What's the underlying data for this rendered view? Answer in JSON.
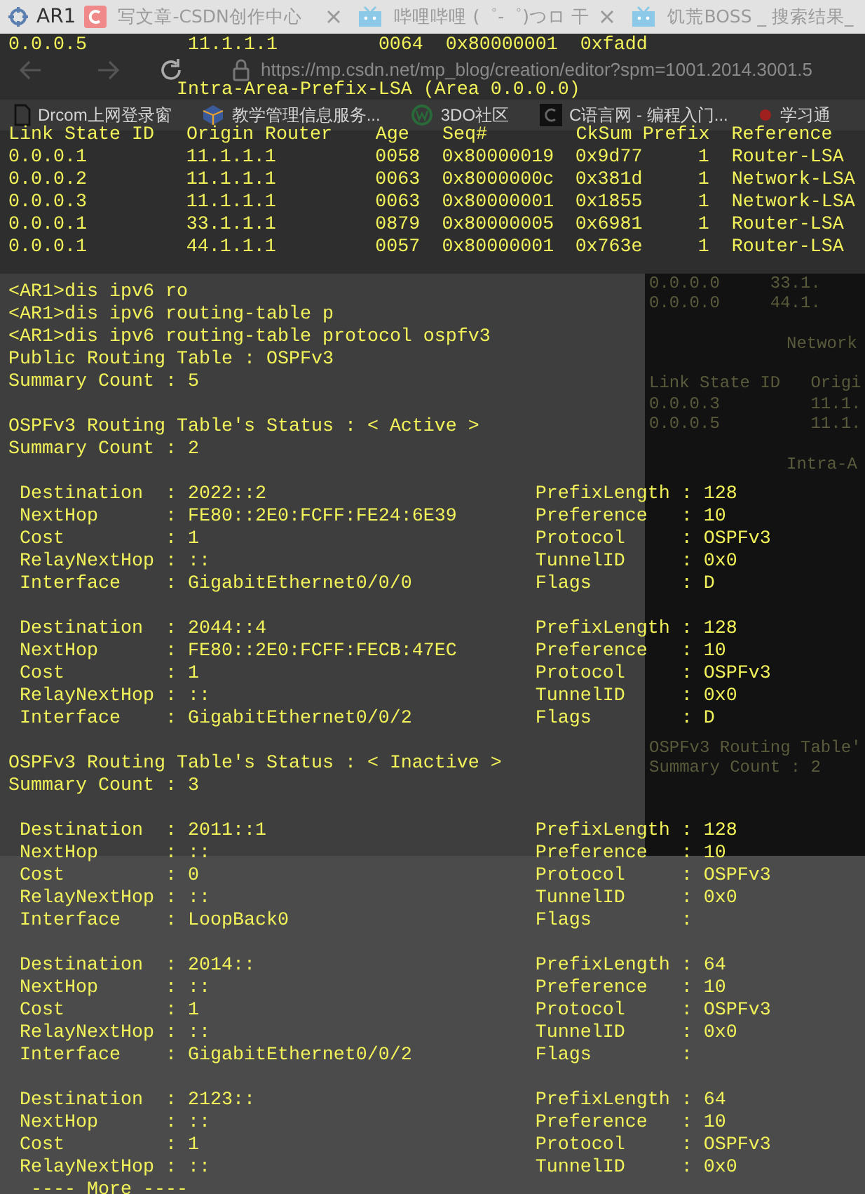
{
  "window": {
    "title": "AR1"
  },
  "browser": {
    "tabs": [
      {
        "title": "写文章-CSDN创作中心"
      },
      {
        "title": "哔哩哔哩 (゜-゜)つロ 干"
      },
      {
        "title": "饥荒BOSS _ 搜索结果_"
      }
    ],
    "url": "https://mp.csdn.net/mp_blog/creation/editor?spm=1001.2014.3001.5",
    "bookmarks": [
      {
        "label": "Drcom上网登录窗"
      },
      {
        "label": "教学管理信息服务..."
      },
      {
        "label": "3DO社区"
      },
      {
        "label": "C语言网 - 编程入门..."
      },
      {
        "label": "学习通"
      }
    ],
    "panel": {
      "top_groups": [
        {
          "kind": "rows",
          "lines": [
            "0.0.0.0     33.1.",
            "0.0.0.0     44.1."
          ]
        },
        {
          "kind": "heading",
          "lines": [
            "Network"
          ]
        },
        {
          "kind": "rows",
          "lines": [
            "Link State ID   Origi",
            "0.0.0.3         11.1.",
            "0.0.0.5         11.1."
          ]
        },
        {
          "kind": "heading",
          "lines": [
            "Intra-A"
          ]
        }
      ],
      "lower_lines": [
        "OSPFv3 Routing Table'",
        "Summary Count : 2"
      ]
    }
  },
  "terminal": {
    "lsa_tail": [
      "0.0.0.5",
      "11.1.1.1",
      "0064",
      "0x80000001",
      "0xfadd"
    ],
    "lsa_title": "Intra-Area-Prefix-LSA (Area 0.0.0.0)",
    "lsa_columns": [
      "Link State ID",
      "Origin Router",
      "Age",
      "Seq#",
      "CkSum",
      "Prefix",
      "Reference"
    ],
    "lsa_rows": [
      [
        "0.0.0.1",
        "11.1.1.1",
        "0058",
        "0x80000019",
        "0x9d77",
        "1",
        "Router-LSA"
      ],
      [
        "0.0.0.2",
        "11.1.1.1",
        "0063",
        "0x8000000c",
        "0x381d",
        "1",
        "Network-LSA"
      ],
      [
        "0.0.0.3",
        "11.1.1.1",
        "0063",
        "0x80000001",
        "0x1855",
        "1",
        "Network-LSA"
      ],
      [
        "0.0.0.1",
        "33.1.1.1",
        "0879",
        "0x80000005",
        "0x6981",
        "1",
        "Router-LSA"
      ],
      [
        "0.0.0.1",
        "44.1.1.1",
        "0057",
        "0x80000001",
        "0x763e",
        "1",
        "Router-LSA"
      ]
    ],
    "output": [
      "<AR1>dis ipv6 ro",
      "<AR1>dis ipv6 routing-table p",
      "<AR1>dis ipv6 routing-table protocol ospfv3",
      "Public Routing Table : OSPFv3",
      "Summary Count : 5"
    ],
    "sections": [
      {
        "status": "OSPFv3 Routing Table's Status : < Active >",
        "count": "Summary Count : 2",
        "routes": [
          [
            [
              "Destination  : 2022::2",
              "PrefixLength : 128"
            ],
            [
              "NextHop      : FE80::2E0:FCFF:FE24:6E39",
              "Preference   : 10"
            ],
            [
              "Cost         : 1",
              "Protocol     : OSPFv3"
            ],
            [
              "RelayNextHop : ::",
              "TunnelID     : 0x0"
            ],
            [
              "Interface    : GigabitEthernet0/0/0",
              "Flags        : D"
            ]
          ],
          [
            [
              "Destination  : 2044::4",
              "PrefixLength : 128"
            ],
            [
              "NextHop      : FE80::2E0:FCFF:FECB:47EC",
              "Preference   : 10"
            ],
            [
              "Cost         : 1",
              "Protocol     : OSPFv3"
            ],
            [
              "RelayNextHop : ::",
              "TunnelID     : 0x0"
            ],
            [
              "Interface    : GigabitEthernet0/0/2",
              "Flags        : D"
            ]
          ]
        ]
      },
      {
        "status": "OSPFv3 Routing Table's Status : < Inactive >",
        "count": "Summary Count : 3",
        "routes": [
          [
            [
              "Destination  : 2011::1",
              "PrefixLength : 128"
            ],
            [
              "NextHop      : ::",
              "Preference   : 10"
            ],
            [
              "Cost         : 0",
              "Protocol     : OSPFv3"
            ],
            [
              "RelayNextHop : ::",
              "TunnelID     : 0x0"
            ],
            [
              "Interface    : LoopBack0",
              "Flags        :"
            ]
          ],
          [
            [
              "Destination  : 2014::",
              "PrefixLength : 64"
            ],
            [
              "NextHop      : ::",
              "Preference   : 10"
            ],
            [
              "Cost         : 1",
              "Protocol     : OSPFv3"
            ],
            [
              "RelayNextHop : ::",
              "TunnelID     : 0x0"
            ],
            [
              "Interface    : GigabitEthernet0/0/2",
              "Flags        :"
            ]
          ],
          [
            [
              "Destination  : 2123::",
              "PrefixLength : 64"
            ],
            [
              "NextHop      : ::",
              "Preference   : 10"
            ],
            [
              "Cost         : 1",
              "Protocol     : OSPFv3"
            ],
            [
              "RelayNextHop : ::",
              "TunnelID     : 0x0"
            ]
          ]
        ]
      }
    ],
    "more": "---- More ----"
  }
}
